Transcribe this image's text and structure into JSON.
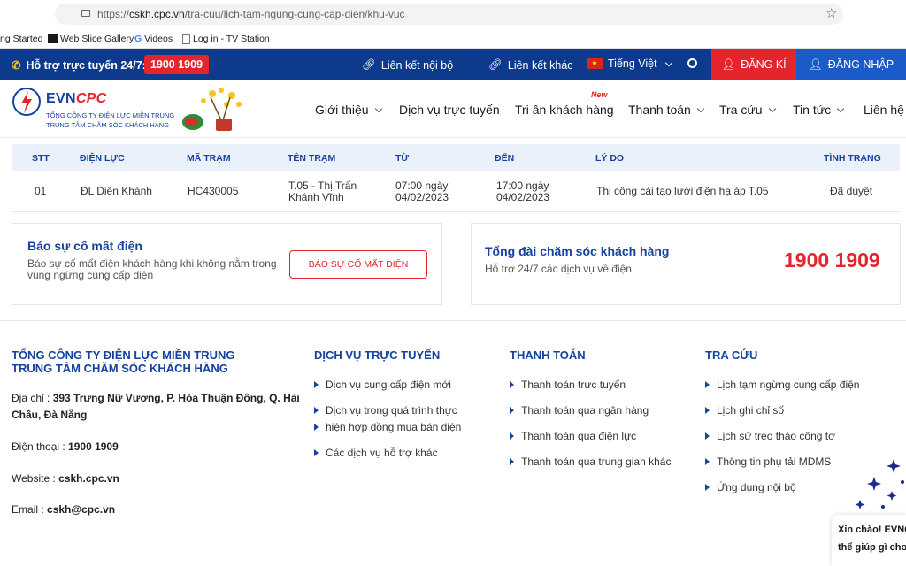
{
  "browser": {
    "url_prefix": "https://",
    "url_domain": "cskh.cpc.vn",
    "url_path": "/tra-cuu/lich-tam-ngung-cung-cap-dien/khu-vuc",
    "bookmarks": [
      "ng Started",
      "Web Slice Gallery",
      "Videos",
      "Log in - TV Station"
    ]
  },
  "topbar": {
    "support_label": "Hỗ trợ trực tuyến 24/7:",
    "hotline": "1900 1909",
    "link_internal": "Liên kết nội bộ",
    "link_other": "Liên kết khác",
    "language": "Tiếng Việt",
    "register": "ĐĂNG KÍ",
    "login": "ĐĂNG NHẬP"
  },
  "header": {
    "brand_evn": "EVN",
    "brand_cpc": "CPC",
    "sub1": "TỔNG CÔNG TY ĐIỆN LỰC MIỀN TRUNG",
    "sub2": "TRUNG TÂM CHĂM SÓC KHÁCH HÀNG",
    "nav": [
      "Giới thiệu",
      "Dịch vụ trực tuyến",
      "Tri ân khách hàng",
      "Thanh toán",
      "Tra cứu",
      "Tin tức",
      "Liên hệ"
    ],
    "new_tag": "New"
  },
  "table": {
    "headers": [
      "STT",
      "ĐIỆN LỰC",
      "MÃ TRẠM",
      "TÊN TRẠM",
      "TỪ",
      "ĐẾN",
      "LÝ DO",
      "TÌNH TRẠNG"
    ],
    "row": {
      "stt": "01",
      "dien_luc": "ĐL Diên Khánh",
      "ma_tram": "HC430005",
      "ten_tram_1": "T.05 - Thị Trấn",
      "ten_tram_2": "Khánh Vĩnh",
      "tu_1": "07:00 ngày",
      "tu_2": "04/02/2023",
      "den_1": "17:00 ngày",
      "den_2": "04/02/2023",
      "ly_do": "Thi công cải tạo lưới điện hạ áp T.05",
      "tinh_trang": "Đã duyệt"
    }
  },
  "report_card": {
    "title": "Báo sự cố mất điện",
    "text_1": "Báo sự cố mất điện khách hàng khi không nằm trong",
    "text_2": "vùng ngừng cung cấp điện",
    "button": "BÁO SỰ CỐ MẤT ĐIỆN"
  },
  "hotline_card": {
    "title": "Tổng đài chăm sóc khách hàng",
    "text": "Hỗ trợ 24/7 các dịch vụ về điện",
    "phone": "1900 1909"
  },
  "footer": {
    "company_1": "TỔNG CÔNG TY ĐIỆN LỰC MIỀN TRUNG",
    "company_2": "TRUNG TÂM CHĂM SÓC KHÁCH HÀNG",
    "address_label": "Địa chỉ : ",
    "address_1": "393 Trưng Nữ Vương, P. Hòa Thuận Đông, Q. Hải",
    "address_2": "Châu, Đà Nẵng",
    "phone_label": "Điện thoại : ",
    "phone": "1900 1909",
    "website_label": "Website : ",
    "website": "cskh.cpc.vn",
    "email_label": "Email : ",
    "email": "cskh@cpc.vn",
    "col_services": {
      "title": "DỊCH VỤ TRỰC TUYẾN",
      "links": [
        "Dịch vụ cung cấp điện mới",
        "Dịch vụ trong quá trình thực",
        "hiện hợp đồng mua bán điện",
        "Các dịch vụ hỗ trợ khác"
      ]
    },
    "col_payment": {
      "title": "THANH TOÁN",
      "links": [
        "Thanh toán trực tuyến",
        "Thanh toán qua ngân hàng",
        "Thanh toán qua điện lực",
        "Thanh toán qua trung gian khác"
      ]
    },
    "col_lookup": {
      "title": "TRA CỨU",
      "links": [
        "Lịch tạm ngừng cung cấp điện",
        "Lịch ghi chỉ số",
        "Lịch sử treo tháo công tơ",
        "Thông tin phụ tải MDMS",
        "Ứng dụng nội bộ"
      ]
    }
  },
  "chat": {
    "line_1": "Xin chào! EVNC",
    "line_2": "thể giúp gì cho"
  }
}
